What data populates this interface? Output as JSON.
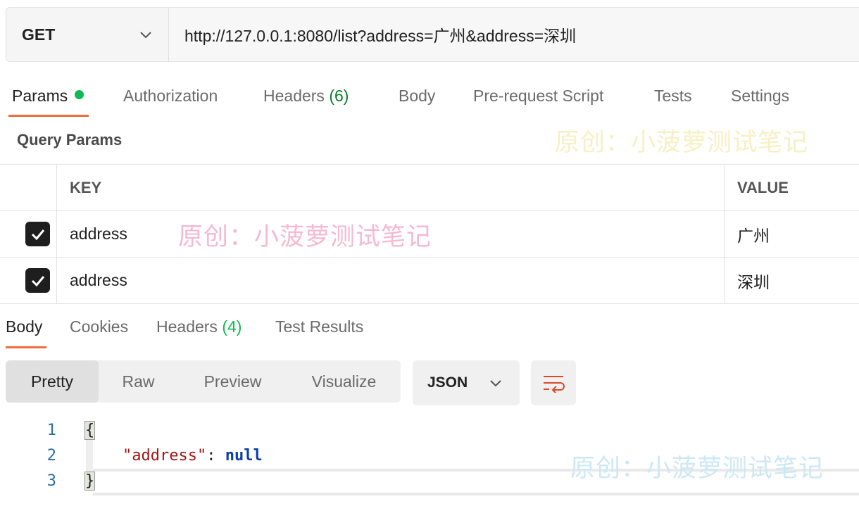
{
  "request": {
    "method": "GET",
    "url": "http://127.0.0.1:8080/list?address=广州&address=深圳"
  },
  "request_tabs": [
    {
      "label": "Params",
      "has_dot": true,
      "active": true
    },
    {
      "label": "Authorization"
    },
    {
      "label": "Headers",
      "count": "(6)"
    },
    {
      "label": "Body"
    },
    {
      "label": "Pre-request Script"
    },
    {
      "label": "Tests"
    },
    {
      "label": "Settings"
    }
  ],
  "query_params": {
    "title": "Query Params",
    "columns": {
      "key": "KEY",
      "value": "VALUE"
    },
    "rows": [
      {
        "checked": true,
        "key": "address",
        "value": "广州"
      },
      {
        "checked": true,
        "key": "address",
        "value": "深圳"
      }
    ]
  },
  "watermark": "原创：小菠萝测试笔记",
  "response_tabs": [
    {
      "label": "Body",
      "active": true
    },
    {
      "label": "Cookies"
    },
    {
      "label": "Headers",
      "count": "(4)"
    },
    {
      "label": "Test Results"
    }
  ],
  "format_modes": [
    "Pretty",
    "Raw",
    "Preview",
    "Visualize"
  ],
  "active_format": "Pretty",
  "language_select": "JSON",
  "icons": {
    "method_dropdown": "chevron-down-icon",
    "lang_dropdown": "chevron-down-icon",
    "wrap": "wrap-lines-icon",
    "check": "checkmark-icon"
  },
  "colors": {
    "accent": "#f26b3a",
    "status_dot": "#0cbb52",
    "json_key": "#a31515",
    "json_null": "#0b3fa6"
  },
  "response_body": {
    "line_numbers": [
      "1",
      "2",
      "3"
    ],
    "open": "{",
    "key": "\"address\"",
    "sep": ": ",
    "value": "null",
    "close": "}"
  }
}
